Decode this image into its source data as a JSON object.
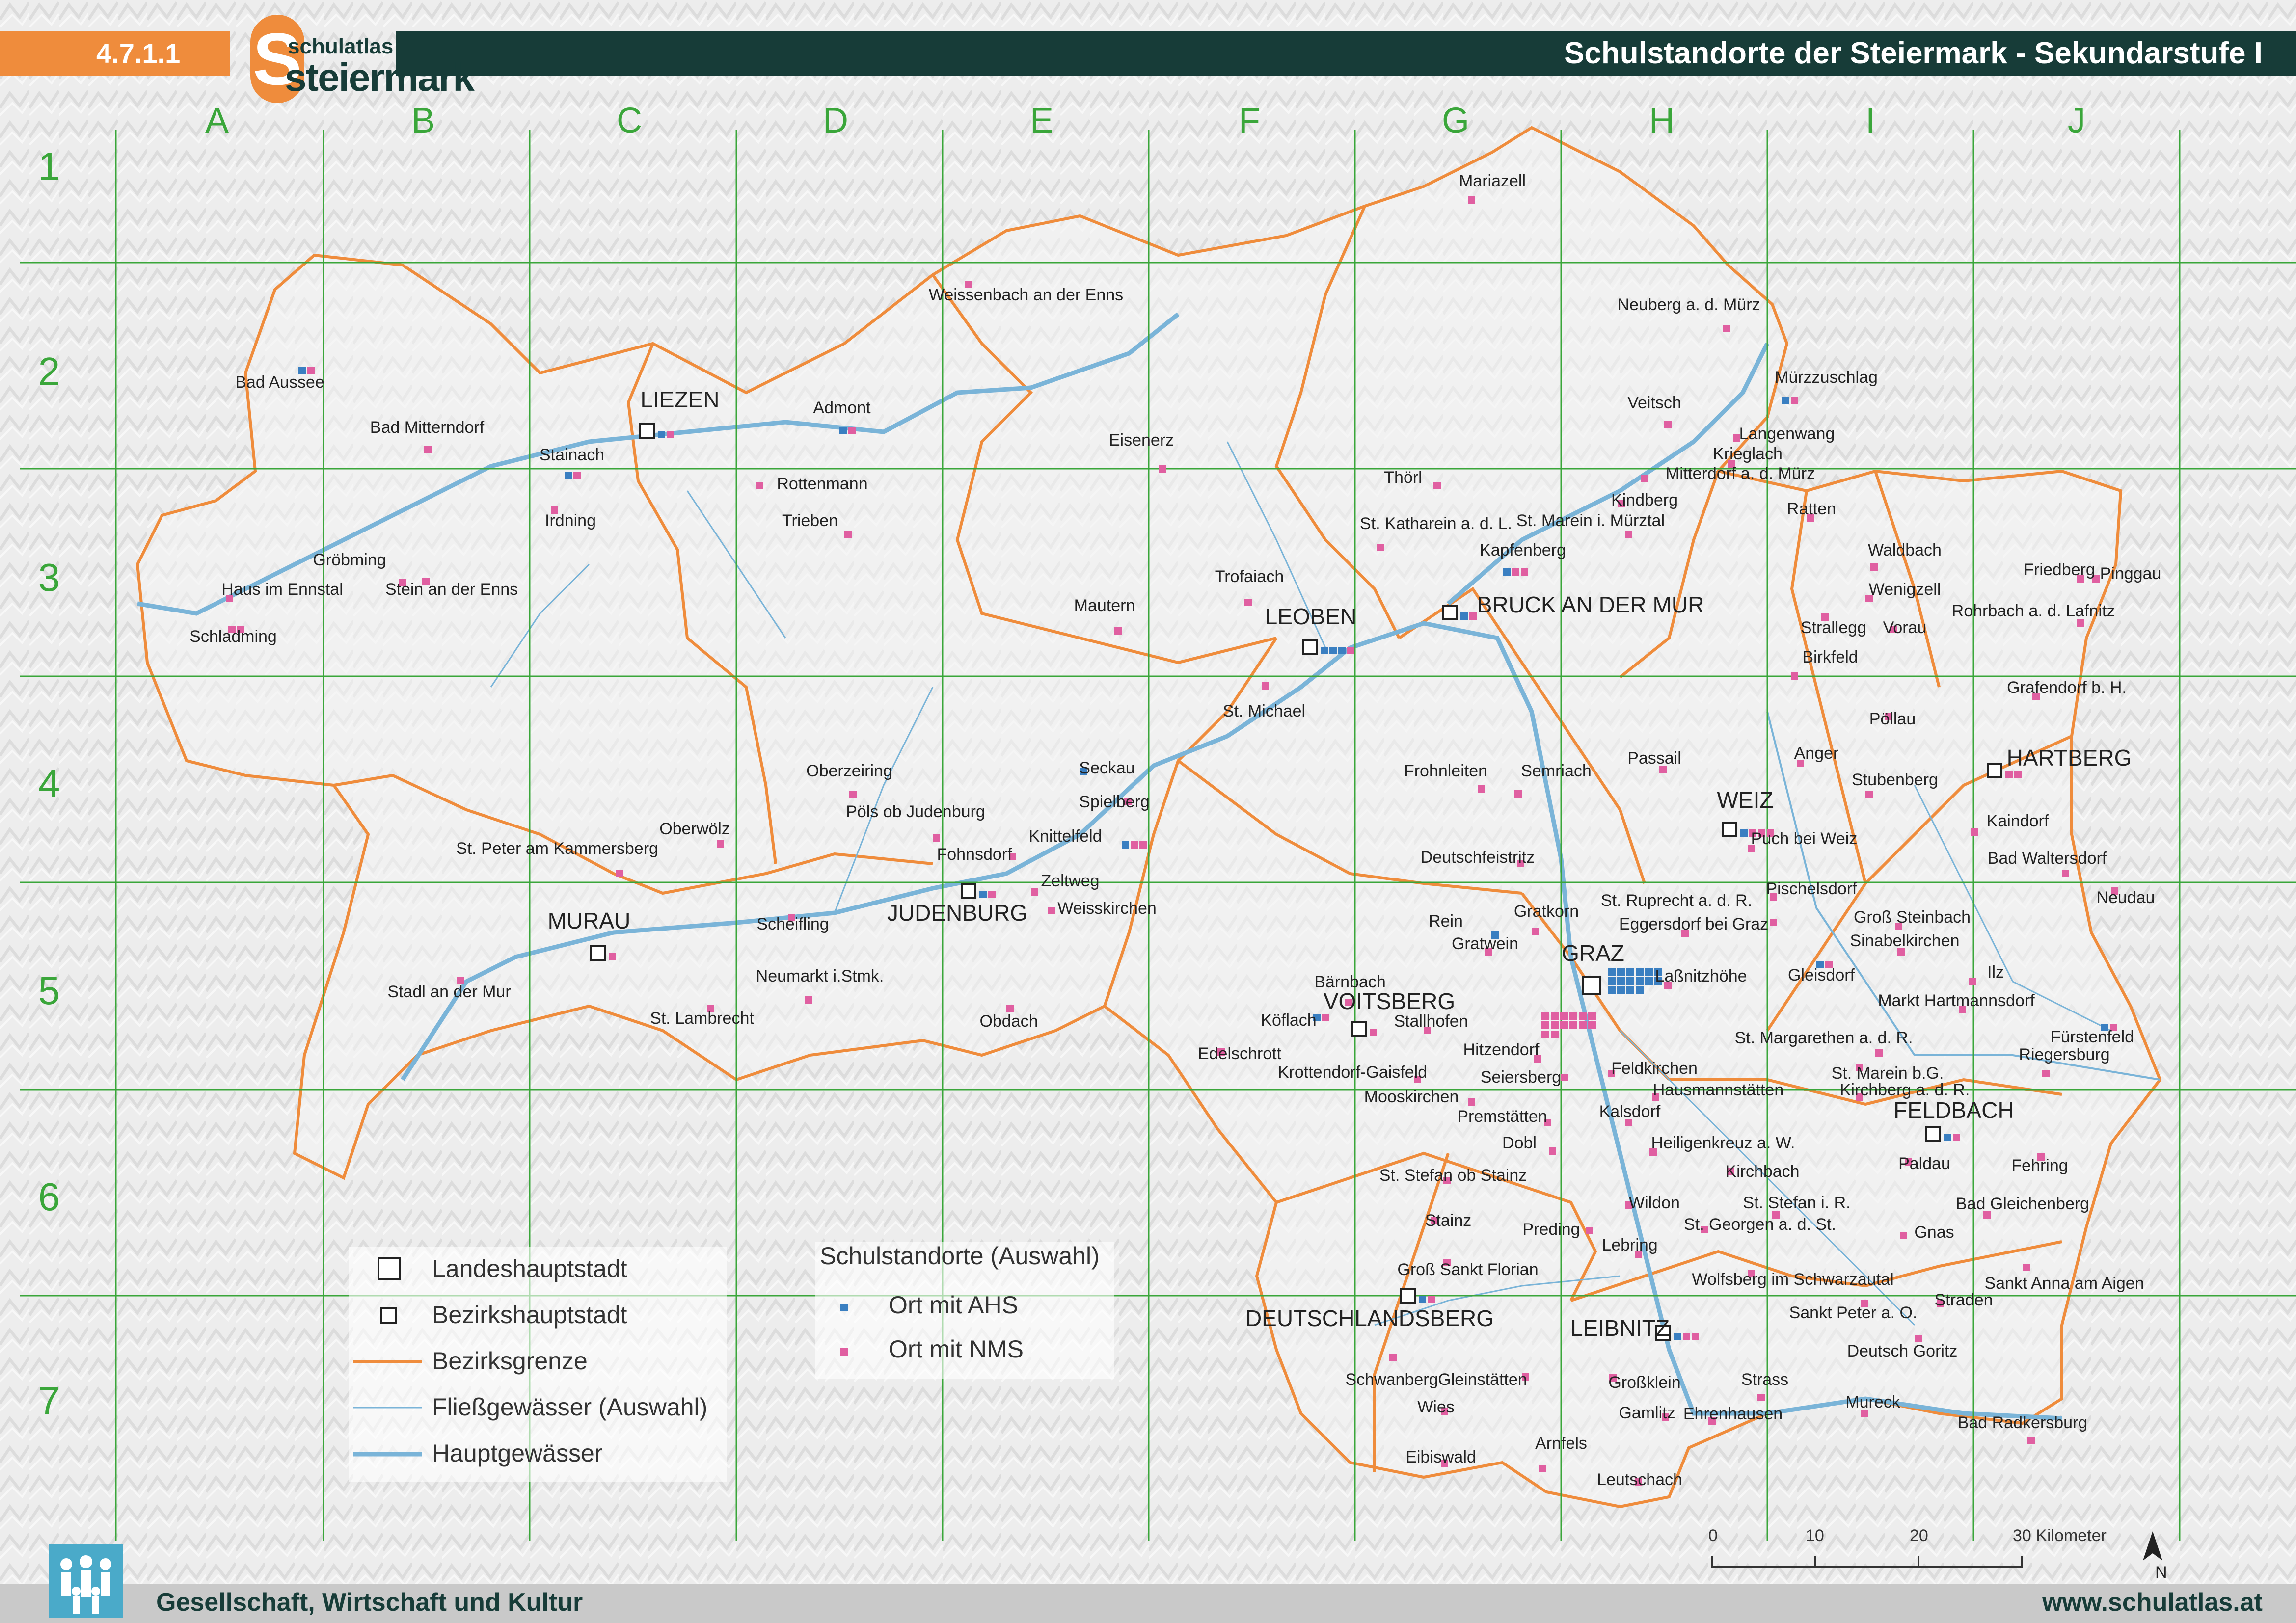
{
  "header": {
    "section_number": "4.7.1.1",
    "logo_small": "schulatlas",
    "logo_large": "steiermark",
    "title": "Schulstandorte der Steiermark - Sekundarstufe I"
  },
  "footer": {
    "category": "Gesellschaft, Wirtschaft und Kultur",
    "url": "www.schulatlas.at",
    "icon": "people-group-icon"
  },
  "grid": {
    "columns": [
      "A",
      "B",
      "C",
      "D",
      "E",
      "F",
      "G",
      "H",
      "I",
      "J"
    ],
    "rows": [
      "1",
      "2",
      "3",
      "4",
      "5",
      "6",
      "7"
    ]
  },
  "legend": {
    "items": [
      {
        "symbol": "large-square",
        "label": "Landeshauptstadt"
      },
      {
        "symbol": "small-square",
        "label": "Bezirkshauptstadt"
      },
      {
        "symbol": "orange-line",
        "label": "Bezirksgrenze"
      },
      {
        "symbol": "thin-blue-line",
        "label": "Fließgewässer (Auswahl)"
      },
      {
        "symbol": "thick-blue-line",
        "label": "Hauptgewässer"
      }
    ],
    "schools_title": "Schulstandorte (Auswahl)",
    "schools": [
      {
        "label": "Ort mit AHS",
        "color": "#3a7fc1"
      },
      {
        "label": "Ort mit NMS",
        "color": "#e05fa1"
      }
    ]
  },
  "scale": {
    "ticks": [
      "0",
      "10",
      "20",
      "30 Kilometer"
    ],
    "north": "N"
  },
  "colors": {
    "ahs": "#3a7fc1",
    "nms": "#e05fa1",
    "border": "#ef8c3c",
    "river": "#7ab4d8",
    "grid": "#3aa63a",
    "header_dark": "#173c38",
    "header_orange": "#ef8c3c"
  },
  "places": [
    {
      "name": "Mariazell",
      "kind": "town",
      "nms": 1,
      "ahs": 0
    },
    {
      "name": "Weissenbach an der Enns",
      "kind": "town",
      "nms": 1,
      "ahs": 0
    },
    {
      "name": "Neuberg a. d. Mürz",
      "kind": "town",
      "nms": 1,
      "ahs": 0
    },
    {
      "name": "Bad Aussee",
      "kind": "town",
      "nms": 1,
      "ahs": 1
    },
    {
      "name": "Bad Mitterndorf",
      "kind": "town",
      "nms": 1,
      "ahs": 0
    },
    {
      "name": "LIEZEN",
      "kind": "district",
      "nms": 1,
      "ahs": 1
    },
    {
      "name": "Admont",
      "kind": "town",
      "nms": 1,
      "ahs": 1
    },
    {
      "name": "Mürzzuschlag",
      "kind": "town",
      "nms": 1,
      "ahs": 1
    },
    {
      "name": "Veitsch",
      "kind": "town",
      "nms": 1,
      "ahs": 0
    },
    {
      "name": "Langenwang",
      "kind": "town",
      "nms": 1,
      "ahs": 0
    },
    {
      "name": "Krieglach",
      "kind": "town",
      "nms": 1,
      "ahs": 0
    },
    {
      "name": "Stainach",
      "kind": "town",
      "nms": 1,
      "ahs": 1
    },
    {
      "name": "Eisenerz",
      "kind": "town",
      "nms": 1,
      "ahs": 0
    },
    {
      "name": "Rottenmann",
      "kind": "town",
      "nms": 1,
      "ahs": 0
    },
    {
      "name": "Thörl",
      "kind": "town",
      "nms": 1,
      "ahs": 0
    },
    {
      "name": "Mitterdorf a. d. Mürz",
      "kind": "town",
      "nms": 1,
      "ahs": 0
    },
    {
      "name": "Irdning",
      "kind": "town",
      "nms": 1,
      "ahs": 0
    },
    {
      "name": "Trieben",
      "kind": "town",
      "nms": 1,
      "ahs": 0
    },
    {
      "name": "Kindberg",
      "kind": "town",
      "nms": 1,
      "ahs": 0
    },
    {
      "name": "Ratten",
      "kind": "town",
      "nms": 1,
      "ahs": 0
    },
    {
      "name": "St. Katharein a. d. L.",
      "kind": "town",
      "nms": 1,
      "ahs": 0
    },
    {
      "name": "St. Marein i. Mürztal",
      "kind": "town",
      "nms": 1,
      "ahs": 0
    },
    {
      "name": "Gröbming",
      "kind": "town",
      "nms": 1,
      "ahs": 0
    },
    {
      "name": "Kapfenberg",
      "kind": "town",
      "nms": 2,
      "ahs": 1
    },
    {
      "name": "Waldbach",
      "kind": "town",
      "nms": 1,
      "ahs": 0
    },
    {
      "name": "Haus im Ennstal",
      "kind": "town",
      "nms": 1,
      "ahs": 0
    },
    {
      "name": "Stein an der Enns",
      "kind": "town",
      "nms": 1,
      "ahs": 0
    },
    {
      "name": "Friedberg",
      "kind": "town",
      "nms": 1,
      "ahs": 0
    },
    {
      "name": "Pinggau",
      "kind": "town",
      "nms": 1,
      "ahs": 0
    },
    {
      "name": "Trofaiach",
      "kind": "town",
      "nms": 1,
      "ahs": 0
    },
    {
      "name": "Wenigzell",
      "kind": "town",
      "nms": 1,
      "ahs": 0
    },
    {
      "name": "Schladming",
      "kind": "town",
      "nms": 2,
      "ahs": 0
    },
    {
      "name": "BRUCK AN DER MUR",
      "kind": "district",
      "nms": 1,
      "ahs": 1
    },
    {
      "name": "Mautern",
      "kind": "town",
      "nms": 1,
      "ahs": 0
    },
    {
      "name": "Rohrbach a. d. Lafnitz",
      "kind": "town",
      "nms": 1,
      "ahs": 0
    },
    {
      "name": "LEOBEN",
      "kind": "district",
      "nms": 1,
      "ahs": 3
    },
    {
      "name": "Strallegg",
      "kind": "town",
      "nms": 1,
      "ahs": 0
    },
    {
      "name": "Vorau",
      "kind": "town",
      "nms": 1,
      "ahs": 0
    },
    {
      "name": "Birkfeld",
      "kind": "town",
      "nms": 1,
      "ahs": 0
    },
    {
      "name": "Grafendorf b. H.",
      "kind": "town",
      "nms": 1,
      "ahs": 0
    },
    {
      "name": "St. Michael",
      "kind": "town",
      "nms": 1,
      "ahs": 0
    },
    {
      "name": "Pöllau",
      "kind": "town",
      "nms": 1,
      "ahs": 0
    },
    {
      "name": "Seckau",
      "kind": "town",
      "nms": 0,
      "ahs": 1
    },
    {
      "name": "Passail",
      "kind": "town",
      "nms": 1,
      "ahs": 0
    },
    {
      "name": "Anger",
      "kind": "town",
      "nms": 1,
      "ahs": 0
    },
    {
      "name": "HARTBERG",
      "kind": "district",
      "nms": 2,
      "ahs": 0
    },
    {
      "name": "Oberzeiring",
      "kind": "town",
      "nms": 1,
      "ahs": 0
    },
    {
      "name": "Frohnleiten",
      "kind": "town",
      "nms": 1,
      "ahs": 0
    },
    {
      "name": "Semriach",
      "kind": "town",
      "nms": 1,
      "ahs": 0
    },
    {
      "name": "Stubenberg",
      "kind": "town",
      "nms": 1,
      "ahs": 0
    },
    {
      "name": "Spielberg",
      "kind": "town",
      "nms": 1,
      "ahs": 0
    },
    {
      "name": "WEIZ",
      "kind": "district",
      "nms": 3,
      "ahs": 1
    },
    {
      "name": "Pöls ob Judenburg",
      "kind": "town",
      "nms": 1,
      "ahs": 0
    },
    {
      "name": "Oberwölz",
      "kind": "town",
      "nms": 1,
      "ahs": 0
    },
    {
      "name": "Kaindorf",
      "kind": "town",
      "nms": 1,
      "ahs": 0
    },
    {
      "name": "Knittelfeld",
      "kind": "town",
      "nms": 2,
      "ahs": 1
    },
    {
      "name": "Puch bei Weiz",
      "kind": "town",
      "nms": 1,
      "ahs": 0
    },
    {
      "name": "Fohnsdorf",
      "kind": "town",
      "nms": 1,
      "ahs": 0
    },
    {
      "name": "St. Peter am Kammersberg",
      "kind": "town",
      "nms": 1,
      "ahs": 0
    },
    {
      "name": "Deutschfeistritz",
      "kind": "town",
      "nms": 1,
      "ahs": 0
    },
    {
      "name": "Bad Waltersdorf",
      "kind": "town",
      "nms": 1,
      "ahs": 0
    },
    {
      "name": "Zeltweg",
      "kind": "town",
      "nms": 1,
      "ahs": 0
    },
    {
      "name": "JUDENBURG",
      "kind": "district",
      "nms": 1,
      "ahs": 1
    },
    {
      "name": "Pischelsdorf",
      "kind": "town",
      "nms": 1,
      "ahs": 0
    },
    {
      "name": "Weisskirchen",
      "kind": "town",
      "nms": 1,
      "ahs": 0
    },
    {
      "name": "St. Ruprecht a. d. R.",
      "kind": "town",
      "nms": 1,
      "ahs": 0
    },
    {
      "name": "Neudau",
      "kind": "town",
      "nms": 1,
      "ahs": 0
    },
    {
      "name": "Gratkorn",
      "kind": "town",
      "nms": 1,
      "ahs": 0
    },
    {
      "name": "Scheifling",
      "kind": "town",
      "nms": 1,
      "ahs": 0
    },
    {
      "name": "Groß Steinbach",
      "kind": "town",
      "nms": 1,
      "ahs": 0
    },
    {
      "name": "Rein",
      "kind": "town",
      "nms": 0,
      "ahs": 1
    },
    {
      "name": "Eggersdorf bei Graz",
      "kind": "town",
      "nms": 1,
      "ahs": 0
    },
    {
      "name": "MURAU",
      "kind": "district",
      "nms": 1,
      "ahs": 0
    },
    {
      "name": "Sinabelkirchen",
      "kind": "town",
      "nms": 1,
      "ahs": 0
    },
    {
      "name": "Gratwein",
      "kind": "town",
      "nms": 1,
      "ahs": 0
    },
    {
      "name": "GRAZ",
      "kind": "capital",
      "nms": 14,
      "ahs": 16
    },
    {
      "name": "Gleisdorf",
      "kind": "town",
      "nms": 1,
      "ahs": 1
    },
    {
      "name": "Laßnitzhöhe",
      "kind": "town",
      "nms": 1,
      "ahs": 0
    },
    {
      "name": "Ilz",
      "kind": "town",
      "nms": 1,
      "ahs": 0
    },
    {
      "name": "Neumarkt i.Stmk.",
      "kind": "town",
      "nms": 1,
      "ahs": 0
    },
    {
      "name": "Bärnbach",
      "kind": "town",
      "nms": 1,
      "ahs": 0
    },
    {
      "name": "Stadl an der Mur",
      "kind": "town",
      "nms": 1,
      "ahs": 0
    },
    {
      "name": "Markt Hartmannsdorf",
      "kind": "town",
      "nms": 1,
      "ahs": 0
    },
    {
      "name": "St. Lambrecht",
      "kind": "town",
      "nms": 1,
      "ahs": 0
    },
    {
      "name": "VOITSBERG",
      "kind": "district",
      "nms": 1,
      "ahs": 0
    },
    {
      "name": "Köflach",
      "kind": "town",
      "nms": 1,
      "ahs": 1
    },
    {
      "name": "Obdach",
      "kind": "town",
      "nms": 1,
      "ahs": 0
    },
    {
      "name": "Stallhofen",
      "kind": "town",
      "nms": 1,
      "ahs": 0
    },
    {
      "name": "Fürstenfeld",
      "kind": "town",
      "nms": 1,
      "ahs": 1
    },
    {
      "name": "St. Margarethen a. d. R.",
      "kind": "town",
      "nms": 1,
      "ahs": 0
    },
    {
      "name": "Hitzendorf",
      "kind": "town",
      "nms": 1,
      "ahs": 0
    },
    {
      "name": "Edelschrott",
      "kind": "town",
      "nms": 1,
      "ahs": 0
    },
    {
      "name": "Riegersburg",
      "kind": "town",
      "nms": 1,
      "ahs": 0
    },
    {
      "name": "Feldkirchen",
      "kind": "town",
      "nms": 1,
      "ahs": 0
    },
    {
      "name": "Krottendorf-Gaisfeld",
      "kind": "town",
      "nms": 1,
      "ahs": 0
    },
    {
      "name": "Seiersberg",
      "kind": "town",
      "nms": 1,
      "ahs": 0
    },
    {
      "name": "St. Marein b.G.",
      "kind": "town",
      "nms": 1,
      "ahs": 0
    },
    {
      "name": "Hausmannstätten",
      "kind": "town",
      "nms": 1,
      "ahs": 0
    },
    {
      "name": "Kirchberg a. d. R.",
      "kind": "town",
      "nms": 1,
      "ahs": 0
    },
    {
      "name": "Mooskirchen",
      "kind": "town",
      "nms": 1,
      "ahs": 0
    },
    {
      "name": "FELDBACH",
      "kind": "district",
      "nms": 1,
      "ahs": 1
    },
    {
      "name": "Premstätten",
      "kind": "town",
      "nms": 1,
      "ahs": 0
    },
    {
      "name": "Kalsdorf",
      "kind": "town",
      "nms": 1,
      "ahs": 0
    },
    {
      "name": "Heiligenkreuz a. W.",
      "kind": "town",
      "nms": 1,
      "ahs": 0
    },
    {
      "name": "Dobl",
      "kind": "town",
      "nms": 1,
      "ahs": 0
    },
    {
      "name": "Paldau",
      "kind": "town",
      "nms": 1,
      "ahs": 0
    },
    {
      "name": "Fehring",
      "kind": "town",
      "nms": 1,
      "ahs": 0
    },
    {
      "name": "Kirchbach",
      "kind": "town",
      "nms": 1,
      "ahs": 0
    },
    {
      "name": "St. Stefan ob Stainz",
      "kind": "town",
      "nms": 1,
      "ahs": 0
    },
    {
      "name": "St. Stefan i. R.",
      "kind": "town",
      "nms": 1,
      "ahs": 0
    },
    {
      "name": "Wildon",
      "kind": "town",
      "nms": 1,
      "ahs": 0
    },
    {
      "name": "Bad Gleichenberg",
      "kind": "town",
      "nms": 1,
      "ahs": 0
    },
    {
      "name": "Stainz",
      "kind": "town",
      "nms": 1,
      "ahs": 0
    },
    {
      "name": "St. Georgen a. d. St.",
      "kind": "town",
      "nms": 1,
      "ahs": 0
    },
    {
      "name": "Preding",
      "kind": "town",
      "nms": 1,
      "ahs": 0
    },
    {
      "name": "Gnas",
      "kind": "town",
      "nms": 1,
      "ahs": 0
    },
    {
      "name": "Lebring",
      "kind": "town",
      "nms": 1,
      "ahs": 0
    },
    {
      "name": "Groß Sankt Florian",
      "kind": "town",
      "nms": 1,
      "ahs": 0
    },
    {
      "name": "Wolfsberg im Schwarzautal",
      "kind": "town",
      "nms": 1,
      "ahs": 0
    },
    {
      "name": "Sankt Anna am Aigen",
      "kind": "town",
      "nms": 1,
      "ahs": 0
    },
    {
      "name": "Straden",
      "kind": "town",
      "nms": 1,
      "ahs": 0
    },
    {
      "name": "DEUTSCHLANDSBERG",
      "kind": "district",
      "nms": 1,
      "ahs": 1
    },
    {
      "name": "Sankt Peter a. O.",
      "kind": "town",
      "nms": 1,
      "ahs": 0
    },
    {
      "name": "LEIBNITZ",
      "kind": "district",
      "nms": 2,
      "ahs": 1
    },
    {
      "name": "Deutsch Goritz",
      "kind": "town",
      "nms": 1,
      "ahs": 0
    },
    {
      "name": "Schwanberg",
      "kind": "town",
      "nms": 1,
      "ahs": 0
    },
    {
      "name": "Gleinstätten",
      "kind": "town",
      "nms": 1,
      "ahs": 0
    },
    {
      "name": "Großklein",
      "kind": "town",
      "nms": 1,
      "ahs": 0
    },
    {
      "name": "Strass",
      "kind": "town",
      "nms": 1,
      "ahs": 0
    },
    {
      "name": "Wies",
      "kind": "town",
      "nms": 1,
      "ahs": 0
    },
    {
      "name": "Gamlitz",
      "kind": "town",
      "nms": 1,
      "ahs": 0
    },
    {
      "name": "Ehrenhausen",
      "kind": "town",
      "nms": 1,
      "ahs": 0
    },
    {
      "name": "Mureck",
      "kind": "town",
      "nms": 1,
      "ahs": 0
    },
    {
      "name": "Bad Radkersburg",
      "kind": "town",
      "nms": 1,
      "ahs": 0
    },
    {
      "name": "Eibiswald",
      "kind": "town",
      "nms": 1,
      "ahs": 0
    },
    {
      "name": "Arnfels",
      "kind": "town",
      "nms": 1,
      "ahs": 0
    },
    {
      "name": "Leutschach",
      "kind": "town",
      "nms": 1,
      "ahs": 0
    }
  ]
}
